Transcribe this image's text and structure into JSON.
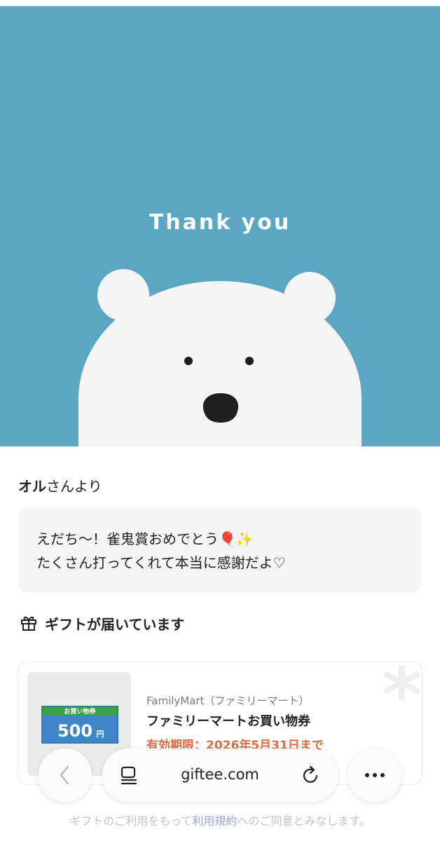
{
  "card": {
    "headline": "Thank you",
    "background_color": "#5aa6c3"
  },
  "sender": {
    "name": "オル",
    "suffix": "さんより"
  },
  "message": {
    "line1": "えだち〜！雀鬼賞おめでとう🎈✨",
    "line2": "たくさん打ってくれて本当に感謝だよ♡"
  },
  "gift_section": {
    "heading": "ギフトが届いています",
    "icon": "gift-icon"
  },
  "gift": {
    "thumbnail_label": "お買い物券",
    "thumbnail_amount": "500",
    "thumbnail_unit": "円",
    "brand": "FamilyMart（ファミリーマート）",
    "product": "ファミリーマートお買い物券",
    "expiry": "有効期限：2026年5月31日まで",
    "accent_color": "#e36b3f"
  },
  "footer": {
    "prefix": "ギフトのご利用をもって",
    "link": "利用規約",
    "suffix": "へのご同意とみなします。"
  },
  "browser": {
    "url": "giftee.com",
    "back_icon": "chevron-left-icon",
    "tabs_icon": "tabs-icon",
    "reload_icon": "reload-icon",
    "more_icon": "more-icon"
  }
}
